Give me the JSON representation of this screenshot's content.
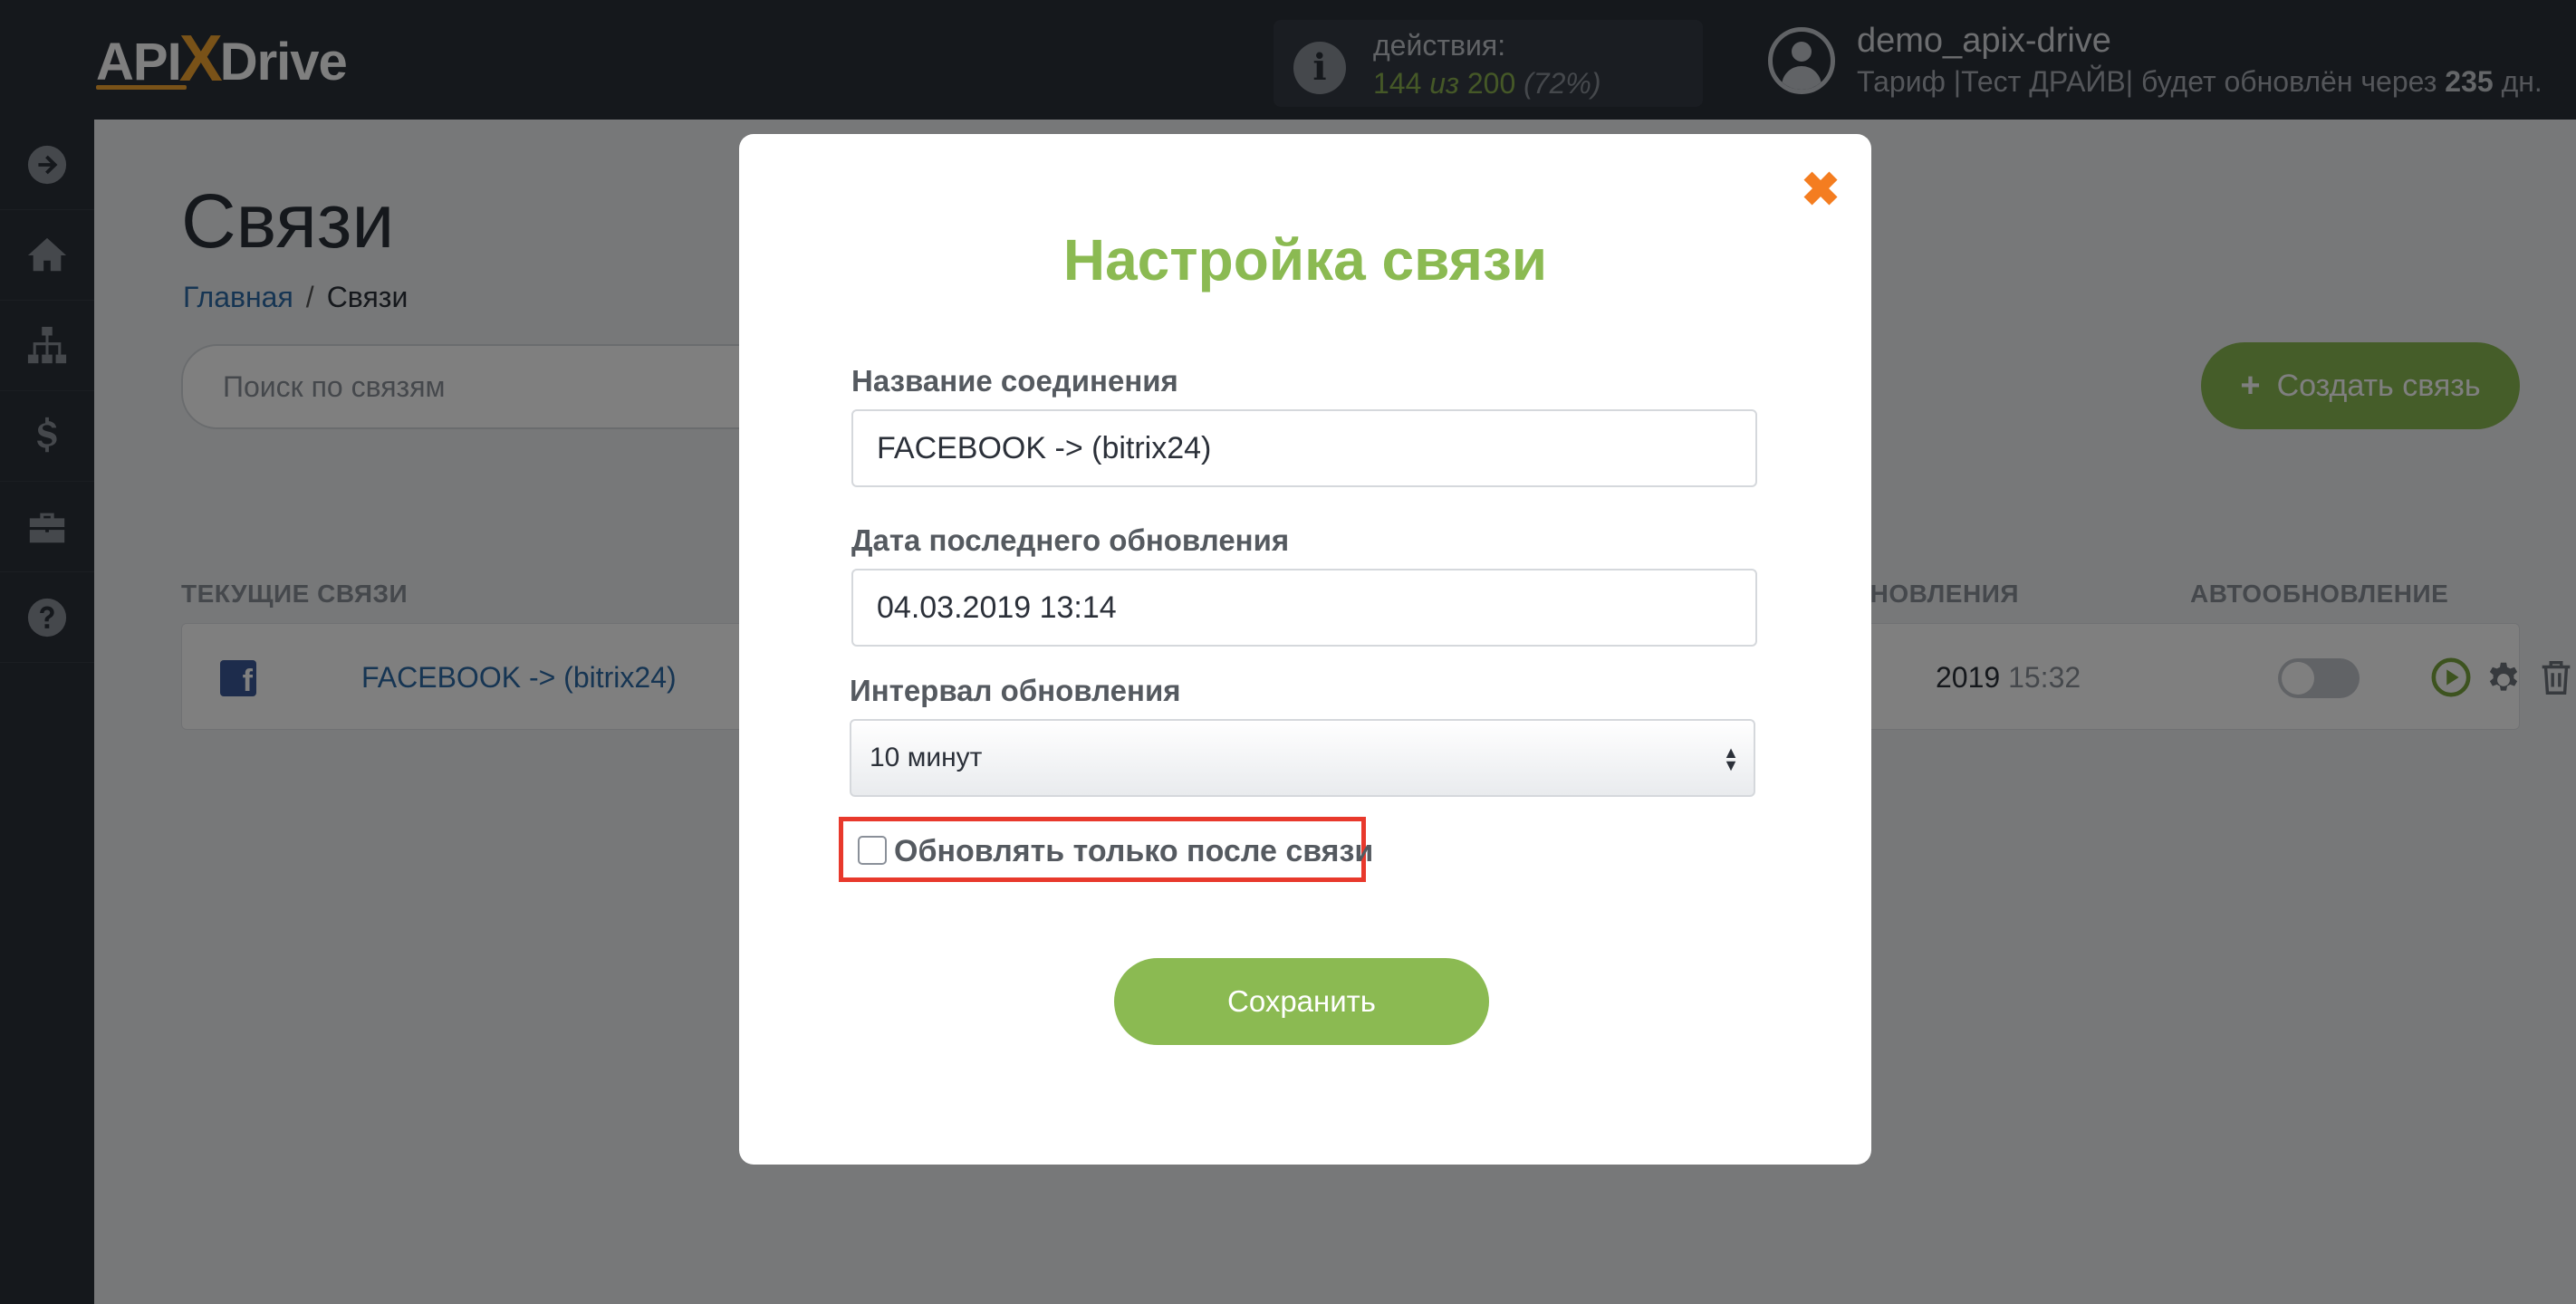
{
  "header": {
    "logo_left": "API",
    "logo_x": "X",
    "logo_right": "Drive",
    "actions_label": "действия:",
    "actions_used": "144",
    "actions_of": "из",
    "actions_total": "200",
    "actions_percent": "(72%)",
    "user_name": "demo_apix-drive",
    "plan_text": "Тариф |Тест ДРАЙВ| будет обновлён через",
    "plan_days": "235",
    "plan_days_unit": "дн."
  },
  "sidebar": {
    "items": [
      {
        "icon": "arrow-right-circle-icon"
      },
      {
        "icon": "home-icon"
      },
      {
        "icon": "sitemap-icon"
      },
      {
        "icon": "dollar-icon"
      },
      {
        "icon": "briefcase-icon"
      },
      {
        "icon": "question-circle-icon"
      }
    ]
  },
  "main": {
    "title": "Связи",
    "breadcrumb_home": "Главная",
    "breadcrumb_sep": "/",
    "breadcrumb_current": "Связи",
    "search_placeholder": "Поиск по связям",
    "create_plus": "+",
    "create_label": "Создать связь",
    "col_current": "ТЕКУЩИЕ СВЯЗИ",
    "col_updates": "БНОВЛЕНИЯ",
    "col_autoupdate": "АВТООБНОВЛЕНИЕ",
    "row": {
      "name": "FACEBOOK -> (bitrix24)",
      "date_part": "2019",
      "time_part": "15:32",
      "autoupdate_on": false
    }
  },
  "modal": {
    "close_symbol": "✖",
    "title": "Настройка связи",
    "name_label": "Название соединения",
    "name_value": "FACEBOOK -> (bitrix24)",
    "date_label": "Дата последнего обновления",
    "date_value": "04.03.2019 13:14",
    "interval_label": "Интервал обновления",
    "interval_value": "10 минут",
    "checkbox_label": "Обновлять только после связи",
    "checkbox_checked": false,
    "save_label": "Сохранить"
  },
  "colors": {
    "accent_green": "#8bba52",
    "header_dark": "#2b3039",
    "close_orange": "#f47d20",
    "highlight_red": "#e8392c",
    "link_blue": "#2d6aa6"
  }
}
